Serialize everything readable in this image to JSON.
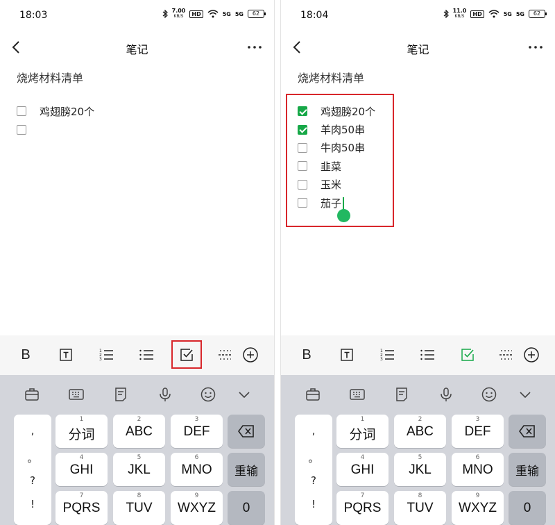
{
  "left": {
    "status": {
      "time": "18:03",
      "speed": "7.00",
      "speed_unit": "KB/S",
      "hd": "HD",
      "sig1": "5G",
      "sig2": "5G",
      "battery": "62"
    },
    "nav": {
      "title": "笔记"
    },
    "note": {
      "title": "烧烤材料清单",
      "items": [
        {
          "text": "鸡翅膀20个",
          "checked": false
        },
        {
          "text": "",
          "checked": false
        }
      ]
    }
  },
  "right": {
    "status": {
      "time": "18:04",
      "speed": "11.0",
      "speed_unit": "KB/S",
      "hd": "HD",
      "sig1": "5G",
      "sig2": "5G",
      "battery": "62"
    },
    "nav": {
      "title": "笔记"
    },
    "note": {
      "title": "烧烤材料清单",
      "items": [
        {
          "text": "鸡翅膀20个",
          "checked": true
        },
        {
          "text": "羊肉50串",
          "checked": true
        },
        {
          "text": "牛肉50串",
          "checked": false
        },
        {
          "text": "韭菜",
          "checked": false
        },
        {
          "text": "玉米",
          "checked": false
        },
        {
          "text": "茄子",
          "checked": false
        }
      ]
    }
  },
  "toolbar": {
    "bold_label": "B",
    "checklist_active_color": "#17a848"
  },
  "keyboard": {
    "punct": [
      ",",
      "。",
      "?",
      "!"
    ],
    "keys": [
      {
        "num": "1",
        "label": "分词"
      },
      {
        "num": "2",
        "label": "ABC"
      },
      {
        "num": "3",
        "label": "DEF"
      },
      {
        "num": "4",
        "label": "GHI"
      },
      {
        "num": "5",
        "label": "JKL"
      },
      {
        "num": "6",
        "label": "MNO"
      },
      {
        "num": "7",
        "label": "PQRS"
      },
      {
        "num": "8",
        "label": "TUV"
      },
      {
        "num": "9",
        "label": "WXYZ"
      }
    ],
    "reenter_label": "重输",
    "zero_label": "0"
  },
  "colors": {
    "accent": "#17a848",
    "highlight": "#d8262b"
  }
}
